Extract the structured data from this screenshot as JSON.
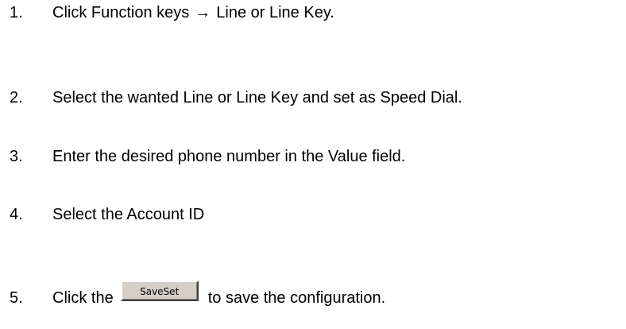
{
  "steps": [
    {
      "number": "1.",
      "text_before": "Click Function keys",
      "arrow": "→",
      "text_after": "Line or Line Key."
    },
    {
      "number": "2.",
      "text": "Select the wanted Line or Line Key and set as Speed Dial."
    },
    {
      "number": "3.",
      "text": "Enter the desired phone number in the Value field."
    },
    {
      "number": "4.",
      "text": "Select the Account ID"
    },
    {
      "number": "5.",
      "text_before": "Click the",
      "button_label": "SaveSet",
      "text_after": "to save the configuration."
    }
  ],
  "colors": {
    "text": "#000000",
    "background": "#ffffff",
    "button_face": "#d4d0c8"
  }
}
